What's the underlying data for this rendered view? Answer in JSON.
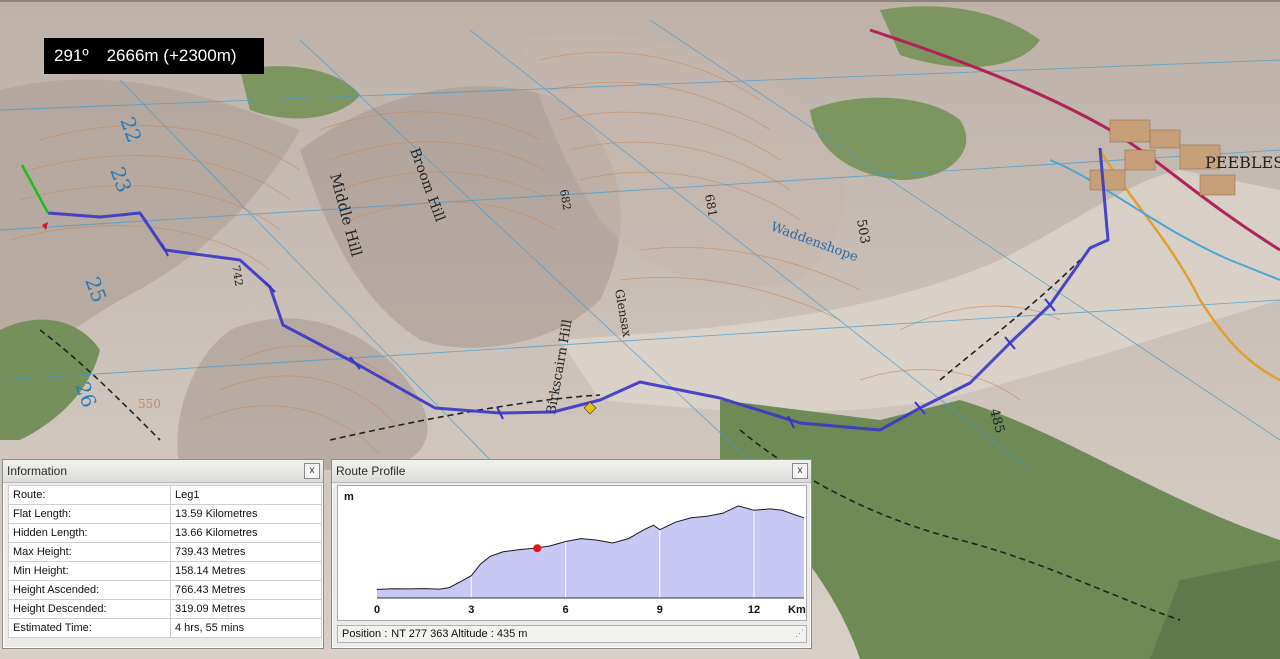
{
  "hud": {
    "heading": "291º",
    "altitude": "2666m (+2300m)"
  },
  "map_labels": {
    "peebles": "PEEBLES",
    "middle_hill": "Middle Hill",
    "broom_hill": "Broom Hill",
    "waddenshope": "Waddenshope",
    "glensax": "Glensax",
    "birkscairn": "Birkscairn Hill",
    "spot_681": "681",
    "spot_503": "503",
    "spot_485": "485",
    "spot_682": "682",
    "spot_742": "742",
    "spot_550": "550",
    "grid_22": "22",
    "grid_23": "23",
    "grid_25": "25",
    "grid_26": "26"
  },
  "information": {
    "title": "Information",
    "close": "x",
    "rows": [
      {
        "key": "Route:",
        "value": "Leg1"
      },
      {
        "key": "Flat Length:",
        "value": "13.59 Kilometres"
      },
      {
        "key": "Hidden Length:",
        "value": "13.66 Kilometres"
      },
      {
        "key": "Max Height:",
        "value": "739.43 Metres"
      },
      {
        "key": "Min Height:",
        "value": "158.14 Metres"
      },
      {
        "key": "Height Ascended:",
        "value": "766.43 Metres"
      },
      {
        "key": "Height Descended:",
        "value": "319.09 Metres"
      },
      {
        "key": "Estimated Time:",
        "value": "4 hrs, 55 mins"
      }
    ]
  },
  "route_profile": {
    "title": "Route Profile",
    "close": "x",
    "position_label": "Position :",
    "position_value": "NT 277 363 Altitude : 435 m"
  },
  "colors": {
    "route": "#3a35c8",
    "profile_fill": "#c8c8f4",
    "marker": "#e0141a",
    "forest": "#6e8a55"
  },
  "chart_data": {
    "type": "area",
    "ylabel": "m",
    "xlabel": "Km",
    "xlim": [
      0,
      13.59
    ],
    "ylim": [
      100,
      800
    ],
    "x_ticks": [
      "0",
      "3",
      "6",
      "9",
      "12"
    ],
    "marker": {
      "x": 5.1,
      "y": 435
    },
    "x": [
      0,
      0.5,
      1,
      1.5,
      2,
      2.3,
      2.7,
      3,
      3.3,
      3.6,
      4,
      4.5,
      5,
      5.5,
      6,
      6.5,
      7,
      7.5,
      8,
      8.5,
      8.8,
      9,
      9.5,
      10,
      10.5,
      11,
      11.5,
      12,
      12.5,
      12.9,
      13.3,
      13.59
    ],
    "y": [
      158,
      162,
      161,
      163,
      160,
      170,
      215,
      250,
      330,
      380,
      410,
      425,
      435,
      450,
      480,
      500,
      490,
      470,
      500,
      560,
      590,
      560,
      610,
      640,
      650,
      670,
      720,
      690,
      700,
      690,
      660,
      640
    ]
  }
}
